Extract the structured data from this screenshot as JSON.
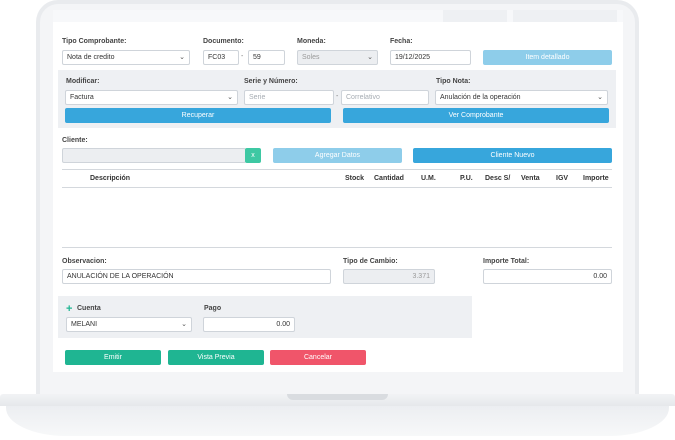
{
  "header": {
    "tipo_comprobante": {
      "label": "Tipo Comprobante:",
      "value": "Nota de credito"
    },
    "documento": {
      "label": "Documento:",
      "serie": "FC03",
      "numero": "59",
      "separator": "-"
    },
    "moneda": {
      "label": "Moneda:",
      "value": "Soles"
    },
    "fecha": {
      "label": "Fecha:",
      "value": "19/12/2025"
    },
    "item_detallado_button": "Item detallado"
  },
  "modificar_panel": {
    "modificar": {
      "label": "Modificar:",
      "value": "Factura"
    },
    "serie_numero": {
      "label": "Serie y Número:",
      "serie_placeholder": "Serie",
      "correlativo_placeholder": "Correlativo",
      "separator": "-"
    },
    "tipo_nota": {
      "label": "Tipo Nota:",
      "value": "Anulación de la operación"
    },
    "recuperar_button": "Recuperar",
    "ver_comprobante_button": "Ver Comprobante"
  },
  "cliente": {
    "label": "Cliente:",
    "value": "",
    "clear_button": "x",
    "agregar_datos_button": "Agregar Datos",
    "cliente_nuevo_button": "Cliente Nuevo"
  },
  "table": {
    "columns": [
      "Descripción",
      "Stock",
      "Cantidad",
      "U.M.",
      "P.U.",
      "Desc S/",
      "Venta",
      "IGV",
      "Importe"
    ],
    "rows": []
  },
  "footer": {
    "observacion": {
      "label": "Observacion:",
      "value": "ANULACIÓN DE LA OPERACIÓN"
    },
    "tipo_cambio": {
      "label": "Tipo de Cambio:",
      "value": "3.371"
    },
    "importe_total": {
      "label": "Importe Total:",
      "value": "0.00"
    }
  },
  "pago_panel": {
    "cuenta": {
      "label": "Cuenta",
      "value": "MELANI"
    },
    "pago": {
      "label": "Pago",
      "value": "0.00"
    }
  },
  "actions": {
    "emitir": "Emitir",
    "vista_previa": "Vista Previa",
    "cancelar": "Cancelar"
  },
  "colors": {
    "primary_blue": "#37a6dc",
    "light_blue": "#8ecdea",
    "green": "#1fb592",
    "red": "#f0556a"
  }
}
